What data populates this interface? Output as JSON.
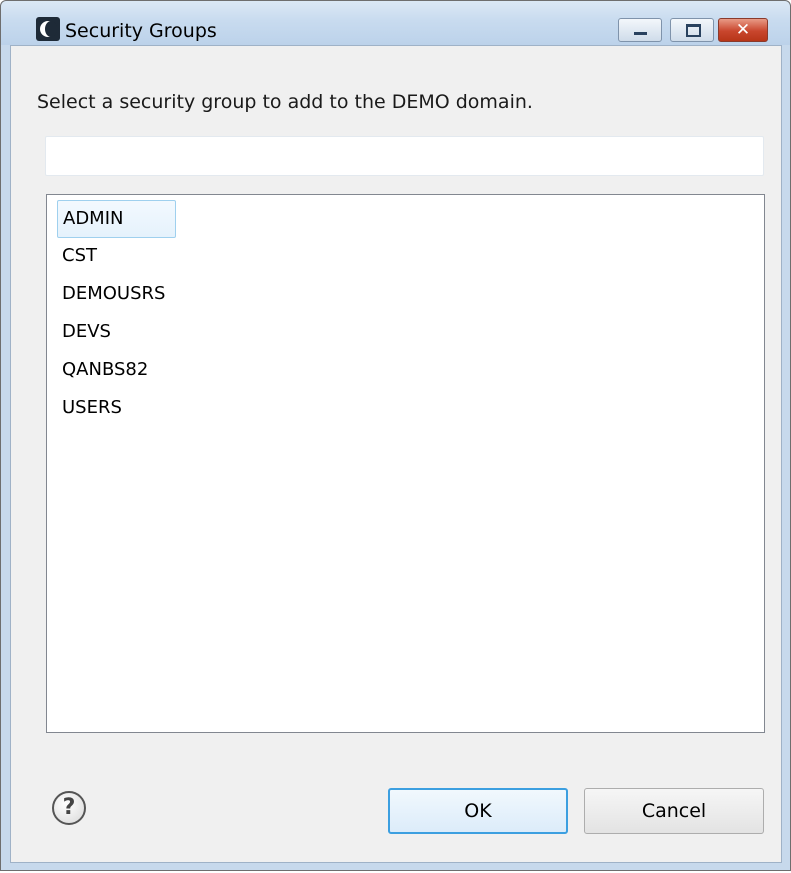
{
  "window": {
    "title": "Security Groups",
    "controls": {
      "minimize": "minimize",
      "maximize": "maximize",
      "close": "✕"
    }
  },
  "dialog": {
    "instruction": "Select a security group to add to the DEMO domain.",
    "filter_value": "",
    "groups": [
      "ADMIN",
      "CST",
      "DEMOUSRS",
      "DEVS",
      "QANBS82",
      "USERS"
    ],
    "selected_group": "ADMIN"
  },
  "buttons": {
    "help": "?",
    "ok": "OK",
    "cancel": "Cancel"
  },
  "colors": {
    "titlebar": "#c8dbef",
    "selection_border": "#9fd0ee",
    "default_button_border": "#3c9fe0"
  }
}
